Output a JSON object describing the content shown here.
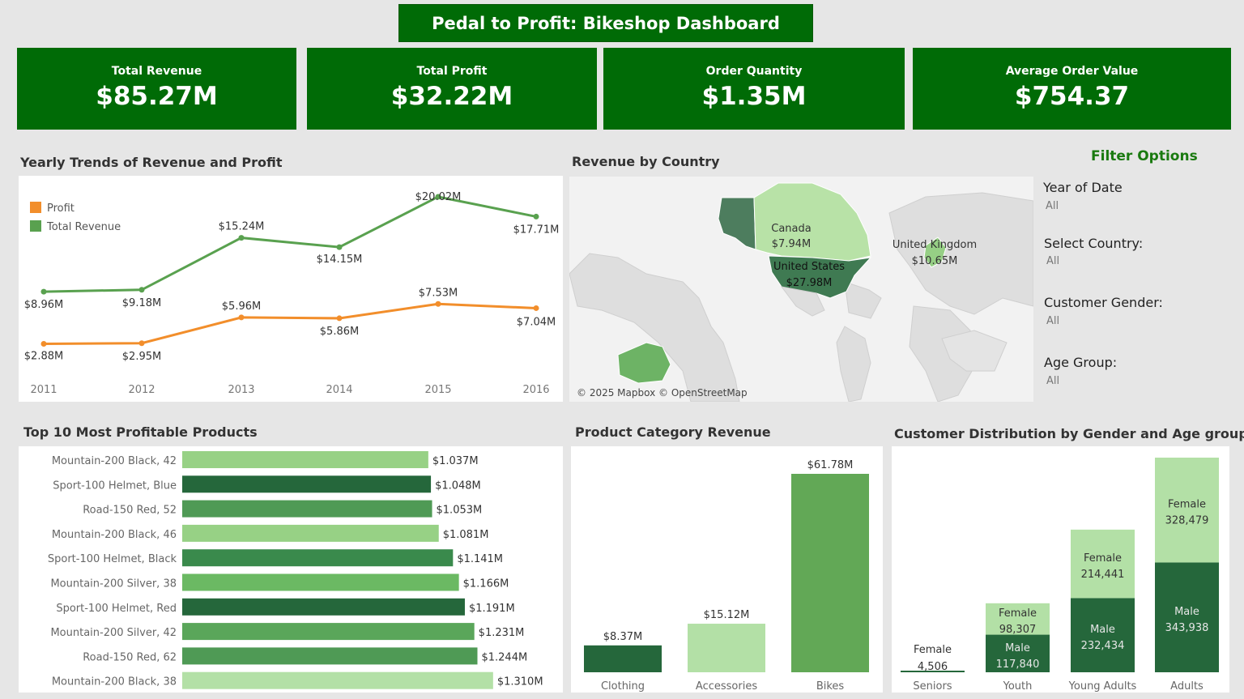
{
  "header": {
    "title": "Pedal to Profit: Bikeshop Dashboard"
  },
  "kpis": [
    {
      "label": "Total Revenue",
      "value": "$85.27M"
    },
    {
      "label": "Total Profit",
      "value": "$32.22M"
    },
    {
      "label": "Order Quantity",
      "value": "$1.35M"
    },
    {
      "label": "Average Order Value",
      "value": "$754.37"
    }
  ],
  "sections": {
    "trends": "Yearly Trends of Revenue and Profit",
    "country": "Revenue by Country",
    "top10": "Top 10 Most Profitable Products",
    "category": "Product Category Revenue",
    "customer": "Customer Distribution by Gender and Age group"
  },
  "map": {
    "attribution": "© 2025 Mapbox © OpenStreetMap",
    "labels": [
      {
        "name": "Canada",
        "value": "$7.94M"
      },
      {
        "name": "United States",
        "value": "$27.98M"
      },
      {
        "name": "United Kingdom",
        "value": "$10.65M"
      }
    ]
  },
  "filters": {
    "title": "Filter Options",
    "items": [
      {
        "label": "Year of Date",
        "value": "All"
      },
      {
        "label": "Select Country:",
        "value": "All"
      },
      {
        "label": "Customer Gender:",
        "value": "All"
      },
      {
        "label": "Age Group:",
        "value": "All"
      }
    ]
  },
  "colors": {
    "banner": "#006b06",
    "profit": "#f28e2b",
    "revenue": "#59a14f",
    "green_dark": "#25673b",
    "green_mid": "#3f8f4e",
    "green_med": "#6bb963",
    "green_light": "#97d185",
    "green_pale": "#b3e0a6"
  },
  "chart_data": [
    {
      "type": "line",
      "x": [
        "2011",
        "2012",
        "2013",
        "2014",
        "2015",
        "2016"
      ],
      "series": [
        {
          "name": "Total Revenue",
          "values": [
            8.96,
            9.18,
            15.24,
            14.15,
            20.02,
            17.71
          ],
          "labels": [
            "$8.96M",
            "$9.18M",
            "$15.24M",
            "$14.15M",
            "$20.02M",
            "$17.71M"
          ]
        },
        {
          "name": "Profit",
          "values": [
            2.88,
            2.95,
            5.96,
            5.86,
            7.53,
            7.04
          ],
          "labels": [
            "$2.88M",
            "$2.95M",
            "$5.96M",
            "$5.86M",
            "$7.53M",
            "$7.04M"
          ]
        }
      ],
      "legend": [
        "Profit",
        "Total Revenue"
      ],
      "legend_position": "top-left"
    },
    {
      "type": "bar",
      "orientation": "horizontal",
      "categories": [
        "Mountain-200 Black, 42",
        "Sport-100 Helmet, Blue",
        "Road-150 Red, 52",
        "Mountain-200 Black, 46",
        "Sport-100 Helmet, Black",
        "Mountain-200 Silver, 38",
        "Sport-100 Helmet, Red",
        "Mountain-200 Silver, 42",
        "Road-150 Red, 62",
        "Mountain-200 Black, 38"
      ],
      "values": [
        1.037,
        1.048,
        1.053,
        1.081,
        1.141,
        1.166,
        1.191,
        1.231,
        1.244,
        1.31
      ],
      "labels": [
        "$1.037M",
        "$1.048M",
        "$1.053M",
        "$1.081M",
        "$1.141M",
        "$1.166M",
        "$1.191M",
        "$1.231M",
        "$1.244M",
        "$1.310M"
      ],
      "bar_colors": [
        "#97d185",
        "#25673b",
        "#4f9a55",
        "#97d185",
        "#3a8a4c",
        "#6bb963",
        "#25673b",
        "#5aa65a",
        "#4f9a55",
        "#b3e0a6"
      ]
    },
    {
      "type": "bar",
      "categories": [
        "Clothing",
        "Accessories",
        "Bikes"
      ],
      "values": [
        8.37,
        15.12,
        61.78
      ],
      "labels": [
        "$8.37M",
        "$15.12M",
        "$61.78M"
      ],
      "bar_colors": [
        "#25673b",
        "#b3e0a6",
        "#62a856"
      ]
    },
    {
      "type": "bar",
      "stacked": true,
      "categories": [
        "Seniors",
        "Youth",
        "Young Adults",
        "Adults"
      ],
      "series": [
        {
          "name": "Male",
          "values": [
            0,
            117840,
            232434,
            343938
          ],
          "color": "#25673b"
        },
        {
          "name": "Female",
          "values": [
            4506,
            98307,
            214441,
            328479
          ],
          "color": "#b3e0a6"
        }
      ],
      "value_labels": {
        "Male": [
          "",
          "117,840",
          "232,434",
          "343,938"
        ],
        "Female": [
          "4,506",
          "98,307",
          "214,441",
          "328,479"
        ]
      }
    }
  ]
}
